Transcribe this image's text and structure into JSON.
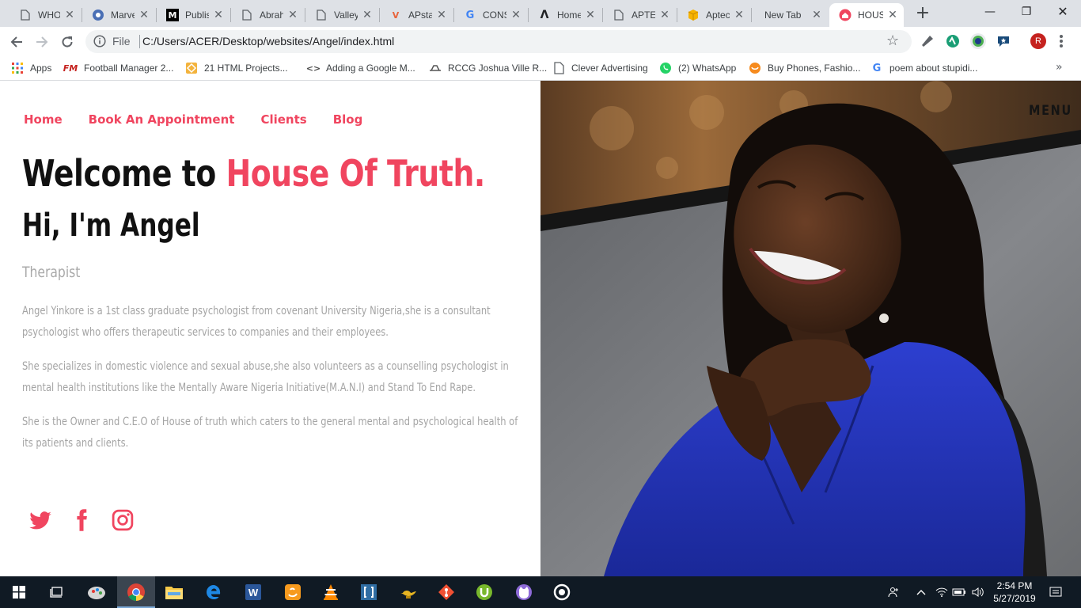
{
  "browser": {
    "tabs": [
      {
        "title": "WHO",
        "icon": "document-icon"
      },
      {
        "title": "Marve",
        "icon": "marvel-icon"
      },
      {
        "title": "Publis",
        "icon": "medium-icon"
      },
      {
        "title": "Abrah",
        "icon": "document-icon"
      },
      {
        "title": "Valley",
        "icon": "document-icon"
      },
      {
        "title": "APsta",
        "icon": "apstar-icon"
      },
      {
        "title": "CONS",
        "icon": "google-icon"
      },
      {
        "title": "Home",
        "icon": "lambda-icon"
      },
      {
        "title": "APTE",
        "icon": "document-icon"
      },
      {
        "title": "Aptec",
        "icon": "box-icon"
      },
      {
        "title": "New Tab",
        "icon": ""
      },
      {
        "title": "HOUS",
        "icon": "house-icon"
      }
    ],
    "omnibox": {
      "scheme": "File",
      "url": "C:/Users/ACER/Desktop/websites/Angel/index.html"
    },
    "avatar_letter": "R",
    "bookmarks": [
      {
        "label": "Apps",
        "icon": "apps-grid-icon"
      },
      {
        "label": "Football Manager 2...",
        "icon": "fm-icon"
      },
      {
        "label": "21 HTML Projects...",
        "icon": "codepen-icon"
      },
      {
        "label": "Adding a Google M...",
        "icon": "code-icon"
      },
      {
        "label": "RCCG Joshua Ville R...",
        "icon": "rccg-icon"
      },
      {
        "label": "Clever Advertising",
        "icon": "document-icon"
      },
      {
        "label": "(2) WhatsApp",
        "icon": "whatsapp-icon"
      },
      {
        "label": "Buy Phones, Fashio...",
        "icon": "jumia-icon"
      },
      {
        "label": "poem about stupidi...",
        "icon": "google-icon"
      }
    ]
  },
  "site": {
    "nav": [
      "Home",
      "Book An Appointment",
      "Clients",
      "Blog"
    ],
    "menu_label": "MENU",
    "welcome_prefix": "Welcome to ",
    "welcome_accent": "House Of Truth.",
    "greeting": "Hi, I'm Angel",
    "role": "Therapist",
    "bio": [
      "Angel Yinkore is a 1st class graduate psychologist from covenant University Nigeria,she is a consultant psychologist who offers therapeutic services to companies and their employees.",
      "She specializes in domestic violence and sexual abuse,she also volunteers as a counselling psychologist in mental health institutions like the Mentally Aware Nigeria Initiative(M.A.N.I) and Stand To End Rape.",
      "She is the Owner and C.E.O of House of truth which caters to the general mental and psychological health of its patients and clients."
    ],
    "social": [
      "twitter-icon",
      "facebook-icon",
      "instagram-icon"
    ],
    "accent_color": "#f0455f"
  },
  "taskbar": {
    "time": "2:54 PM",
    "date": "5/27/2019"
  }
}
